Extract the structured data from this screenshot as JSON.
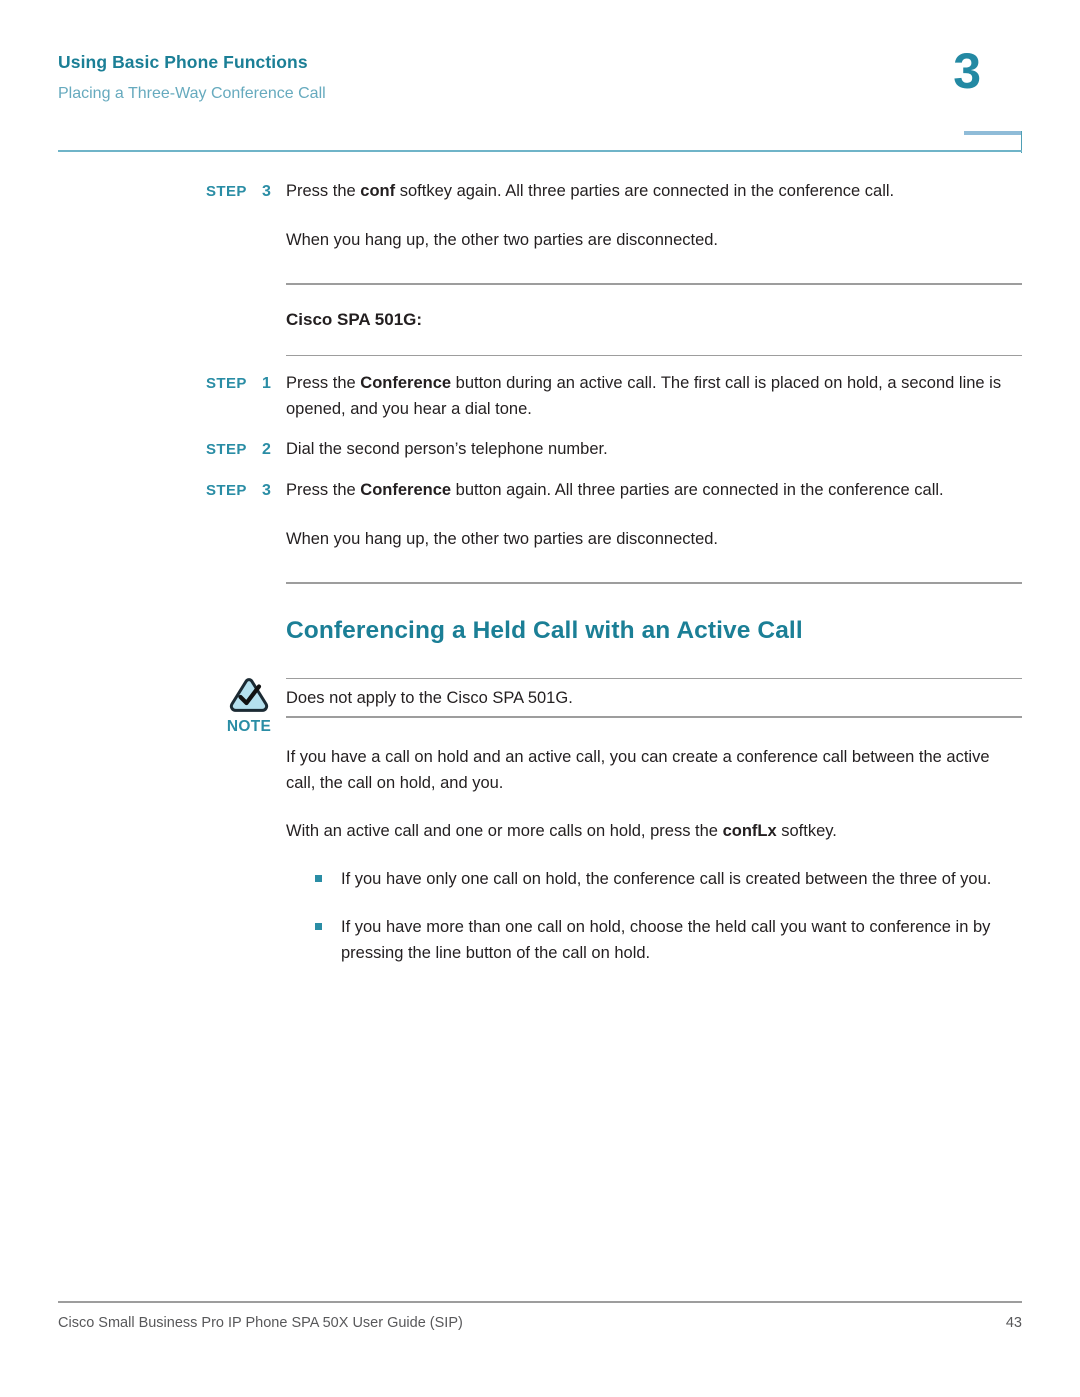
{
  "header": {
    "title": "Using Basic Phone Functions",
    "subtitle": "Placing a Three-Way Conference Call",
    "chapter_number": "3",
    "accent_color": "#1b7f96",
    "subtitle_color": "#66aabe",
    "rule_color": "#6fb4c8"
  },
  "content": {
    "step_label": "STEP",
    "top_steps": [
      {
        "number": "3",
        "text_before": "Press the ",
        "bold": "conf",
        "text_after": " softkey again. All three parties are connected in the conference call."
      }
    ],
    "top_note_paragraph": "When you hang up, the other two parties are disconnected.",
    "sub_heading": "Cisco SPA 501G:",
    "spa501g_steps": [
      {
        "number": "1",
        "text_before": "Press the ",
        "bold": "Conference",
        "text_after": " button during an active call. The first call is placed on hold, a second line is opened, and you hear a dial tone."
      },
      {
        "number": "2",
        "text_before": "Dial the second person’s telephone number.",
        "bold": "",
        "text_after": ""
      },
      {
        "number": "3",
        "text_before": "Press the ",
        "bold": "Conference",
        "text_after": " button again. All three parties are connected in the conference call."
      }
    ],
    "spa501g_closing_paragraph": "When you hang up, the other two parties are disconnected.",
    "section_heading": "Conferencing a Held Call with an Active Call",
    "note": {
      "icon_name": "note-triangle-check-icon",
      "label": "NOTE",
      "text": "Does not apply to the Cisco SPA 501G.",
      "label_color": "#2a8da5",
      "icon_fill": "#b5e0ee",
      "icon_stroke": "#1b2a33"
    },
    "paragraphs": [
      "If you have a call on hold and an active call, you can create a conference call between the active call, the call on hold, and you."
    ],
    "softkey_paragraph": {
      "text_before": "With an active call and one or more calls on hold, press the ",
      "bold": "confLx",
      "text_after": " softkey."
    },
    "bullets": [
      "If you have only one call on hold, the conference call is created between the three of you.",
      "If you have more than one call on hold, choose the held call you want to conference in by pressing the line button of the call on hold."
    ],
    "bullet_color": "#2a8da5"
  },
  "footer": {
    "left": "Cisco Small Business Pro IP Phone SPA 50X User Guide (SIP)",
    "page_number": "43"
  }
}
